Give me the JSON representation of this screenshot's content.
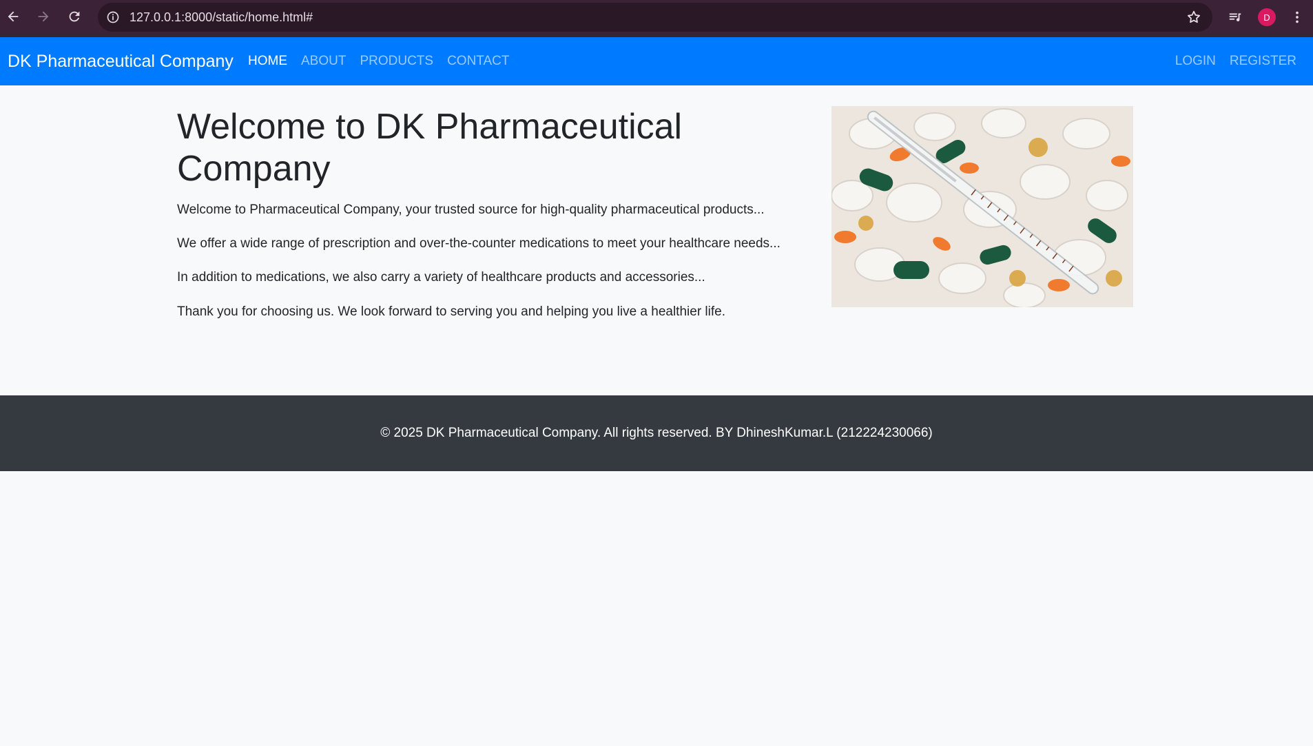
{
  "browser": {
    "url": "127.0.0.1:8000/static/home.html#",
    "profile_initial": "D",
    "icons": [
      "back-icon",
      "forward-icon",
      "reload-icon",
      "site-info-icon",
      "bookmark-star-icon",
      "media-queue-icon",
      "more-vert-icon"
    ]
  },
  "navbar": {
    "brand": "DK Pharmaceutical Company",
    "links": [
      "HOME",
      "ABOUT",
      "PRODUCTS",
      "CONTACT"
    ],
    "right_links": [
      "LOGIN",
      "REGISTER"
    ],
    "color": "#007bff"
  },
  "main": {
    "heading": "Welcome to DK Pharmaceutical Company",
    "paragraphs": [
      "Welcome to Pharmaceutical Company, your trusted source for high-quality pharmaceutical products...",
      "We offer a wide range of prescription and over-the-counter medications to meet your healthcare needs...",
      "In addition to medications, we also carry a variety of healthcare products and accessories...",
      "Thank you for choosing us. We look forward to serving you and helping you live a healthier life."
    ],
    "image": "pills-and-thermometer-photo"
  },
  "footer": {
    "text": "© 2025 DK Pharmaceutical Company. All rights reserved. BY DhineshKumar.L (212224230066)",
    "color": "#343a40"
  }
}
